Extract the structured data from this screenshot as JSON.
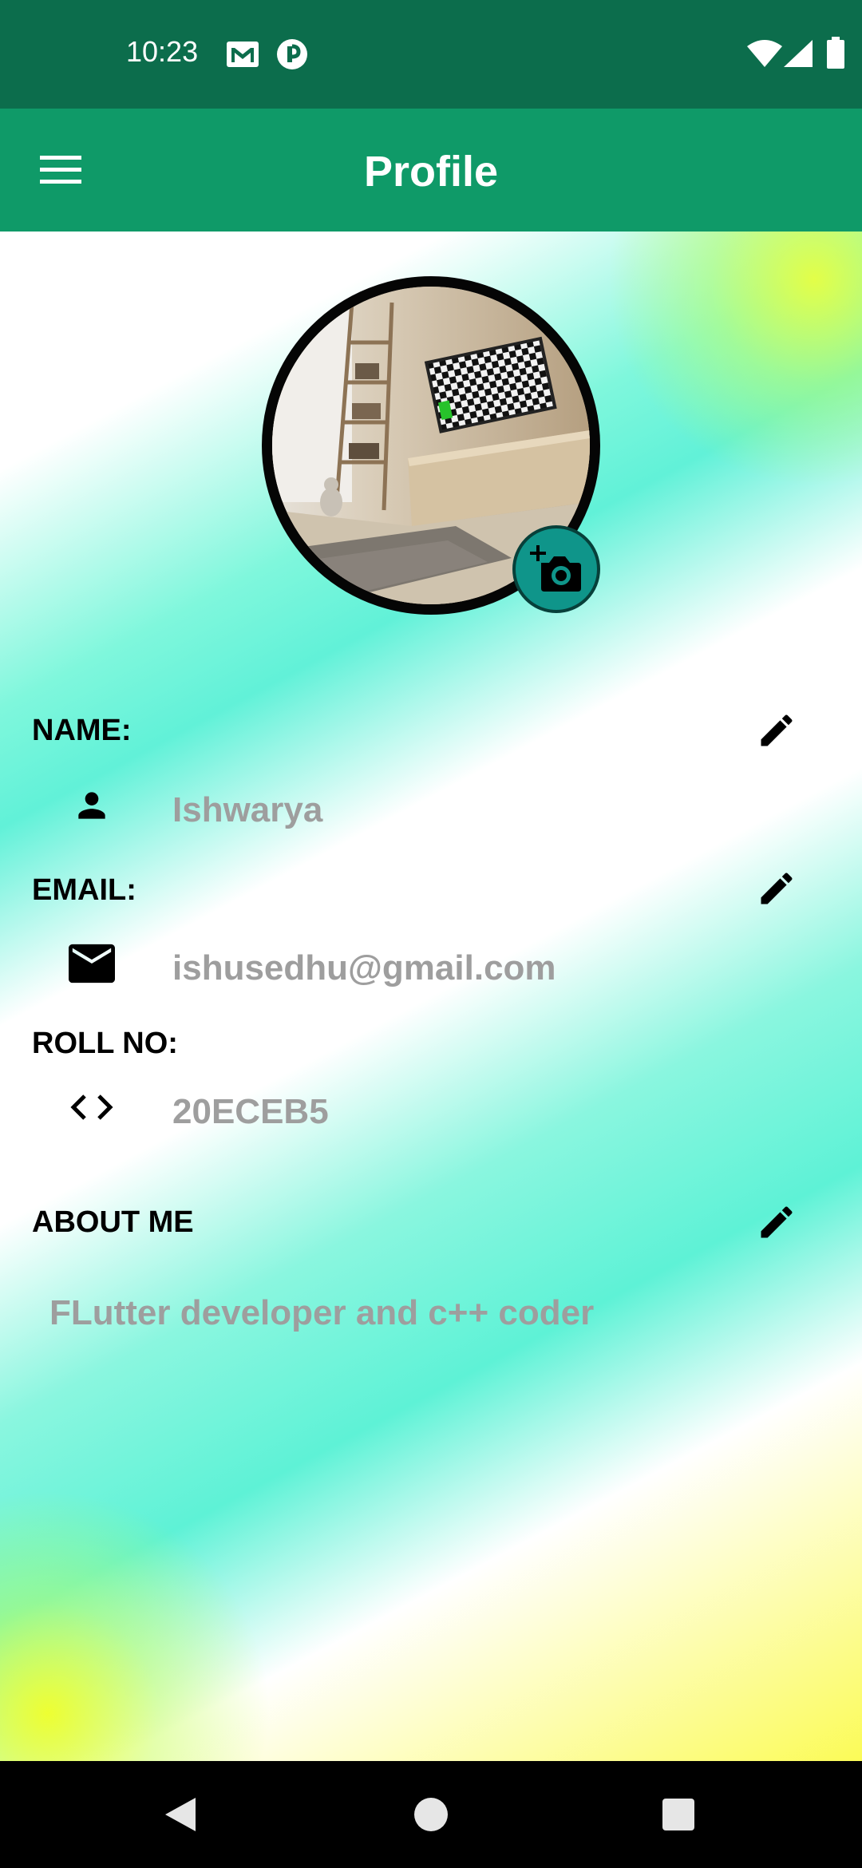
{
  "status_bar": {
    "time": "10:23",
    "left_icons": [
      "gmail-icon",
      "app-icon"
    ],
    "right_icons": [
      "wifi-icon",
      "signal-icon",
      "battery-icon"
    ]
  },
  "app_bar": {
    "title": "Profile",
    "menu_icon": "menu-icon"
  },
  "profile": {
    "avatar_icon": "profile-photo",
    "camera_icon": "add-photo-icon"
  },
  "fields": {
    "name": {
      "label": "NAME:",
      "value": "Ishwarya",
      "icon": "person-icon"
    },
    "email": {
      "label": "EMAIL:",
      "value": "ishusedhu@gmail.com",
      "icon": "mail-icon"
    },
    "roll": {
      "label": "ROLL NO:",
      "value": "20ECEB5",
      "icon": "code-icon"
    }
  },
  "about": {
    "label": "ABOUT ME",
    "text": "FLutter developer and c++ coder"
  },
  "colors": {
    "status_bar": "#0c6d4c",
    "app_bar": "#0f9a68",
    "accent": "#0f958a",
    "value_text": "#9e9e9e"
  },
  "nav_bar": {
    "icons": [
      "back-icon",
      "home-icon",
      "recents-icon"
    ]
  }
}
